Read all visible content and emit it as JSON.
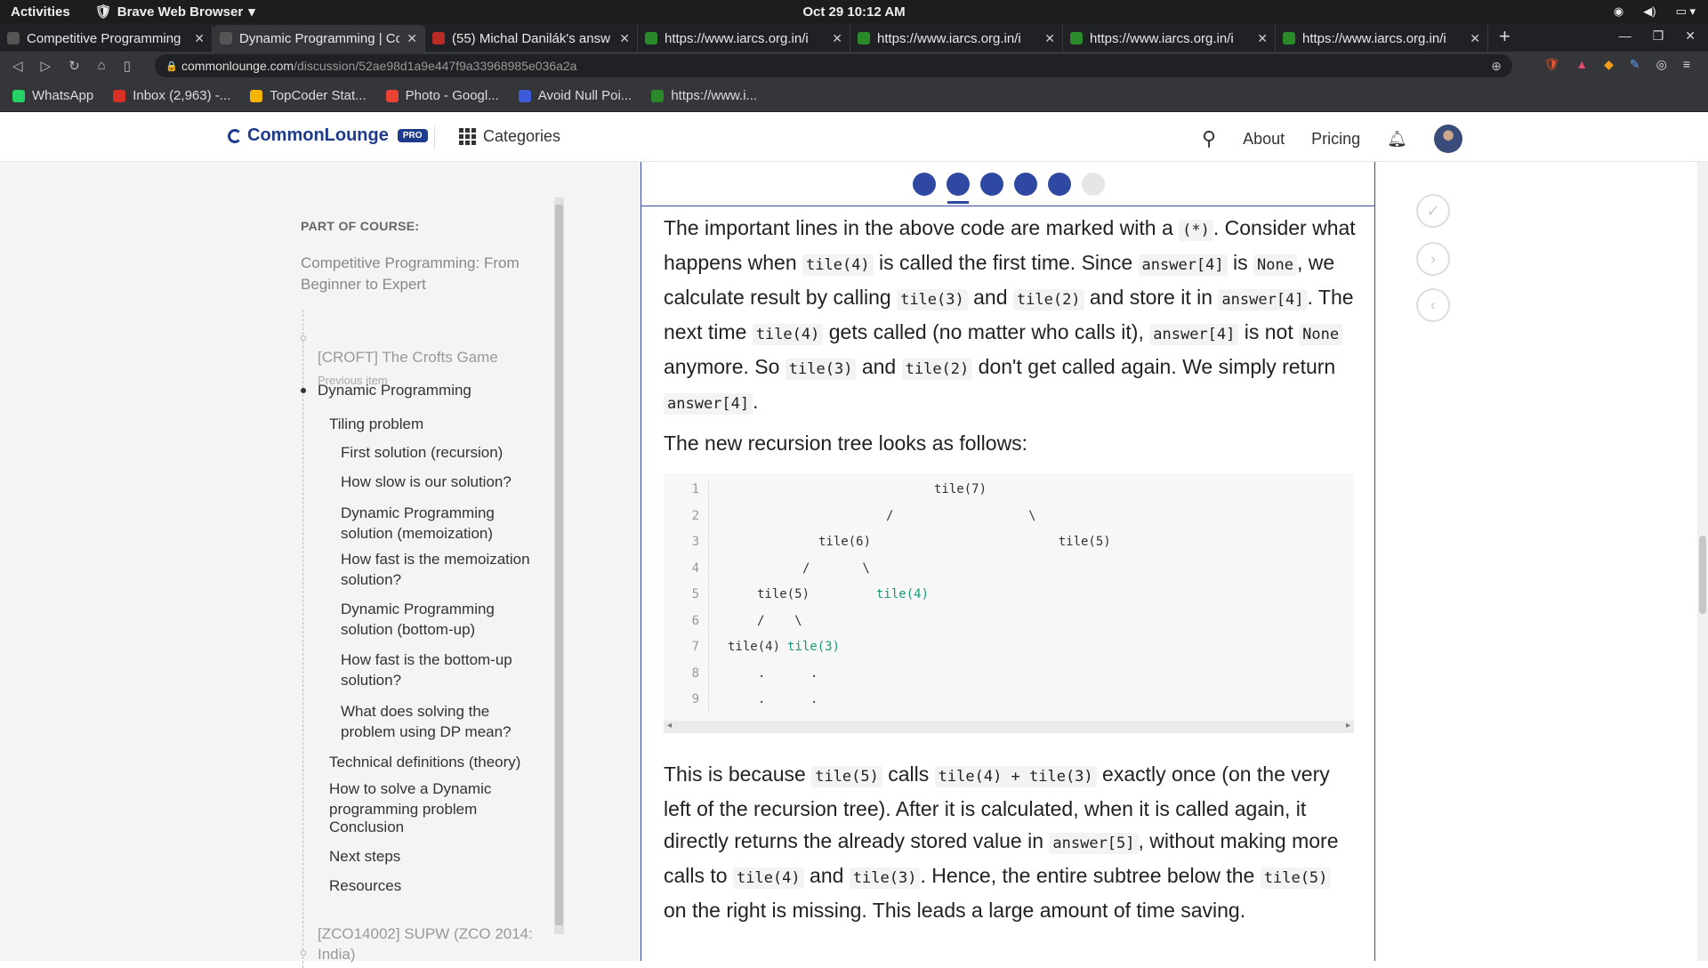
{
  "os": {
    "activities": "Activities",
    "app": "Brave Web Browser",
    "clock": "Oct 29  10:12 AM"
  },
  "tabs": [
    {
      "title": "Competitive Programming",
      "color": "#555"
    },
    {
      "title": "Dynamic Programming | Co",
      "color": "#555"
    },
    {
      "title": "(55) Michal Danilák's answ",
      "color": "#b92b27"
    },
    {
      "title": "https://www.iarcs.org.in/i",
      "color": "#2a8a2a"
    },
    {
      "title": "https://www.iarcs.org.in/i",
      "color": "#2a8a2a"
    },
    {
      "title": "https://www.iarcs.org.in/i",
      "color": "#2a8a2a"
    },
    {
      "title": "https://www.iarcs.org.in/i",
      "color": "#2a8a2a"
    }
  ],
  "url": {
    "host": "commonlounge.com",
    "path": "/discussion/52ae98d1a9e447f9a33968985e036a2a"
  },
  "bookmarks": [
    {
      "label": "WhatsApp",
      "color": "#25d366"
    },
    {
      "label": "Inbox (2,963) -...",
      "color": "#d93025"
    },
    {
      "label": "TopCoder Stat...",
      "color": "#f4b400"
    },
    {
      "label": "Photo - Googl...",
      "color": "#ea4335"
    },
    {
      "label": "Avoid Null Poi...",
      "color": "#3b5bdb"
    },
    {
      "label": "https://www.i...",
      "color": "#2a8a2a"
    }
  ],
  "site": {
    "logo": "CommonLounge",
    "pro": "PRO",
    "categories": "Categories",
    "about": "About",
    "pricing": "Pricing"
  },
  "sidebar": {
    "part_of_course": "PART OF COURSE:",
    "course": "Competitive Programming: From Beginner to Expert",
    "prev_title": "[CROFT] The Crofts Game",
    "prev_label": "Previous item",
    "current": "Dynamic Programming",
    "items": [
      {
        "label": "Tiling problem"
      },
      {
        "label": "First solution (recursion)"
      },
      {
        "label": "How slow is our solution?"
      },
      {
        "label": "Dynamic Programming solution (memoization)"
      },
      {
        "label": "How fast is the memoization solution?"
      },
      {
        "label": "Dynamic Programming solution (bottom-up)"
      },
      {
        "label": "How fast is the bottom-up solution?"
      },
      {
        "label": "What does solving the problem using DP mean?"
      },
      {
        "label": "Technical definitions (theory)"
      },
      {
        "label": "How to solve a Dynamic programming problem"
      },
      {
        "label": "Conclusion"
      },
      {
        "label": "Next steps"
      },
      {
        "label": "Resources"
      }
    ],
    "next_title": "[ZCO14002] SUPW (ZCO 2014: India)"
  },
  "article": {
    "p1": {
      "a": "The important lines in the above code are marked with a ",
      "c1": "(*)",
      "b": ". Consider what happens when ",
      "c2": "tile(4)",
      "d": " is called the first time. Since ",
      "c3": "answer[4]",
      "e": " is ",
      "c4": "None",
      "f": ", we calculate result by calling ",
      "c5": "tile(3)",
      "g": " and ",
      "c6": "tile(2)",
      "h": " and store it in ",
      "c7": "answer[4]",
      "i": ". The next time ",
      "c8": "tile(4)",
      "j": " gets called (no matter who calls it), ",
      "c9": "answer[4]",
      "k": " is not ",
      "c10": "None",
      "l": " anymore. So ",
      "c11": "tile(3)",
      "m": " and ",
      "c12": "tile(2)",
      "n": " don't get called again. We simply return ",
      "c13": "answer[4]",
      "o": "."
    },
    "p2": "The new recursion tree looks as follows:",
    "code_lines": [
      {
        "n": "1",
        "t": "tile(7)"
      },
      {
        "n": "2",
        "t": "/                  \\"
      },
      {
        "n": "3",
        "t": "tile(6)                         tile(5)"
      },
      {
        "n": "4",
        "t": "/       \\"
      },
      {
        "n": "5",
        "t": "tile(5)",
        "g": "tile(4)"
      },
      {
        "n": "6",
        "t": "/    \\"
      },
      {
        "n": "7",
        "t": "tile(4)",
        "g": "tile(3)"
      },
      {
        "n": "8",
        "t": ".      ."
      },
      {
        "n": "9",
        "t": ".      ."
      }
    ],
    "p3": {
      "a": "This is because ",
      "c1": "tile(5)",
      "b": " calls ",
      "c2": "tile(4) + tile(3)",
      "c": " exactly once (on the very left of the recursion tree). After it is calculated, when it is called again, it directly returns the already stored value in ",
      "c3": "answer[5]",
      "d": ", without making more calls to ",
      "c4": "tile(4)",
      "e": " and ",
      "c5": "tile(3)",
      "f": ". Hence, the entire subtree below the ",
      "c6": "tile(5)",
      "g": " on the right is missing. This leads a large amount of time saving."
    }
  },
  "progress": {
    "total": 6,
    "completed": 5,
    "current_index": 2
  }
}
